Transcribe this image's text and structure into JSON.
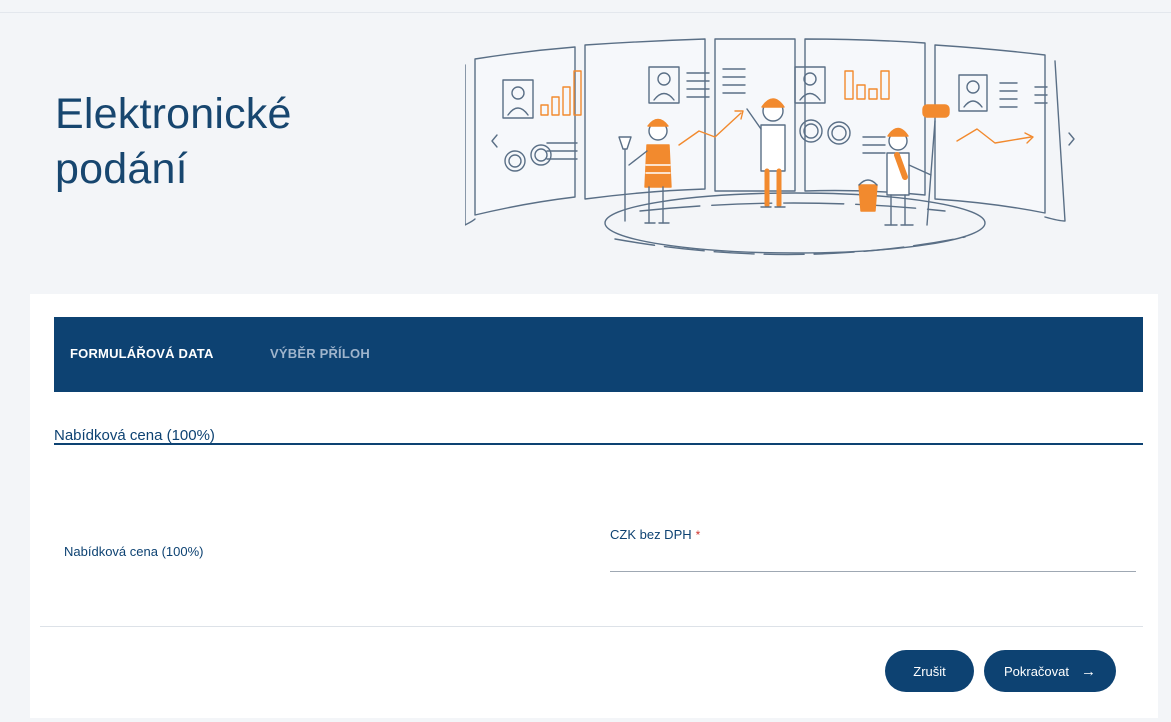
{
  "hero": {
    "title": "Elektronické\npodání"
  },
  "tabs": [
    {
      "label": "FORMULÁŘOVÁ DATA",
      "active": true
    },
    {
      "label": "VÝBĚR PŘÍLOH",
      "active": false
    }
  ],
  "section": {
    "title": "Nabídková cena (100%)"
  },
  "field": {
    "label": "Nabídková cena (100%)",
    "input_label": "CZK bez DPH",
    "required_mark": "*",
    "value": ""
  },
  "buttons": {
    "cancel": "Zrušit",
    "continue": "Pokračovat",
    "continue_icon": "arrow-right-icon"
  },
  "colors": {
    "primary": "#0d4272",
    "accent_orange": "#f28a2e",
    "required": "#d0342c",
    "background": "#f3f5f8"
  }
}
